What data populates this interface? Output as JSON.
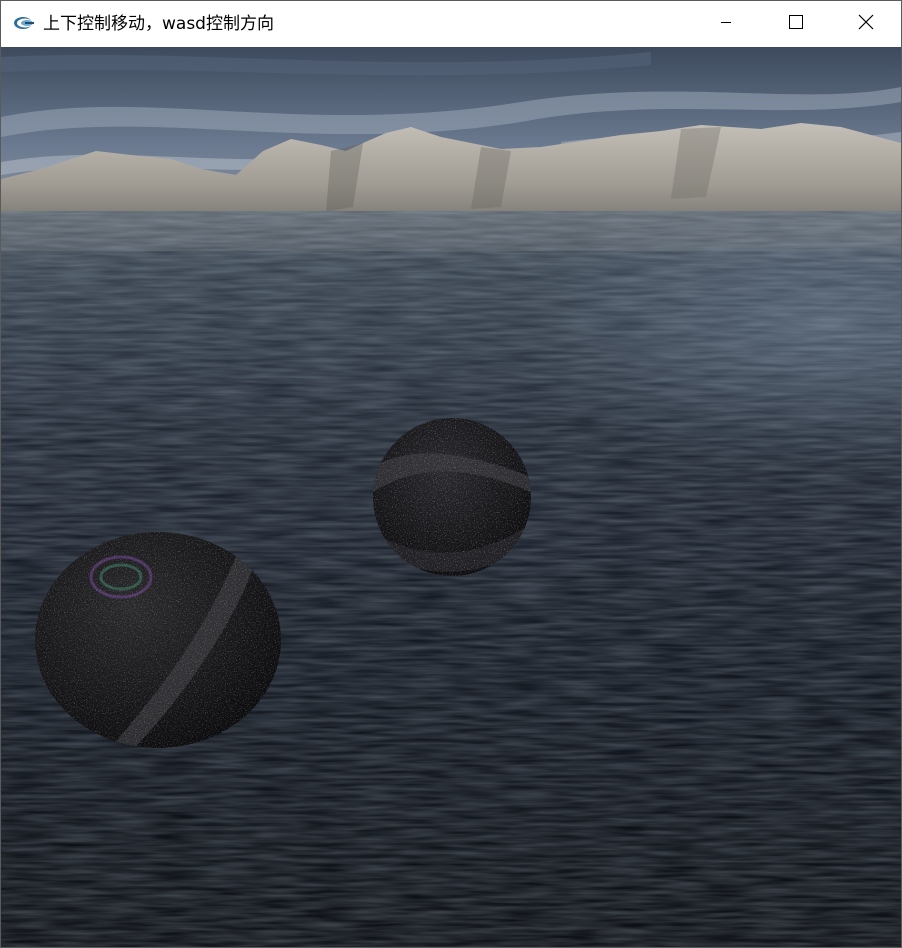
{
  "window": {
    "title": "上下控制移动，wasd控制方向",
    "icons": {
      "app": "app-logo-icon",
      "minimize": "minimize-icon",
      "maximize": "maximize-icon",
      "close": "close-icon"
    }
  },
  "scene": {
    "colors": {
      "sky_top": "#3f4b5e",
      "sky_mid": "#6e7d93",
      "sky_horizon": "#8d96a2",
      "mountain_light": "#b9b5ad",
      "mountain_dark": "#7d7b75",
      "water_far": "#4a5462",
      "water_mid": "#1e2531",
      "water_near": "#0b0e14",
      "sphere_base": "#141414"
    },
    "objects": [
      "mountain-range",
      "water-surface",
      "small-sphere",
      "large-sphere"
    ]
  }
}
